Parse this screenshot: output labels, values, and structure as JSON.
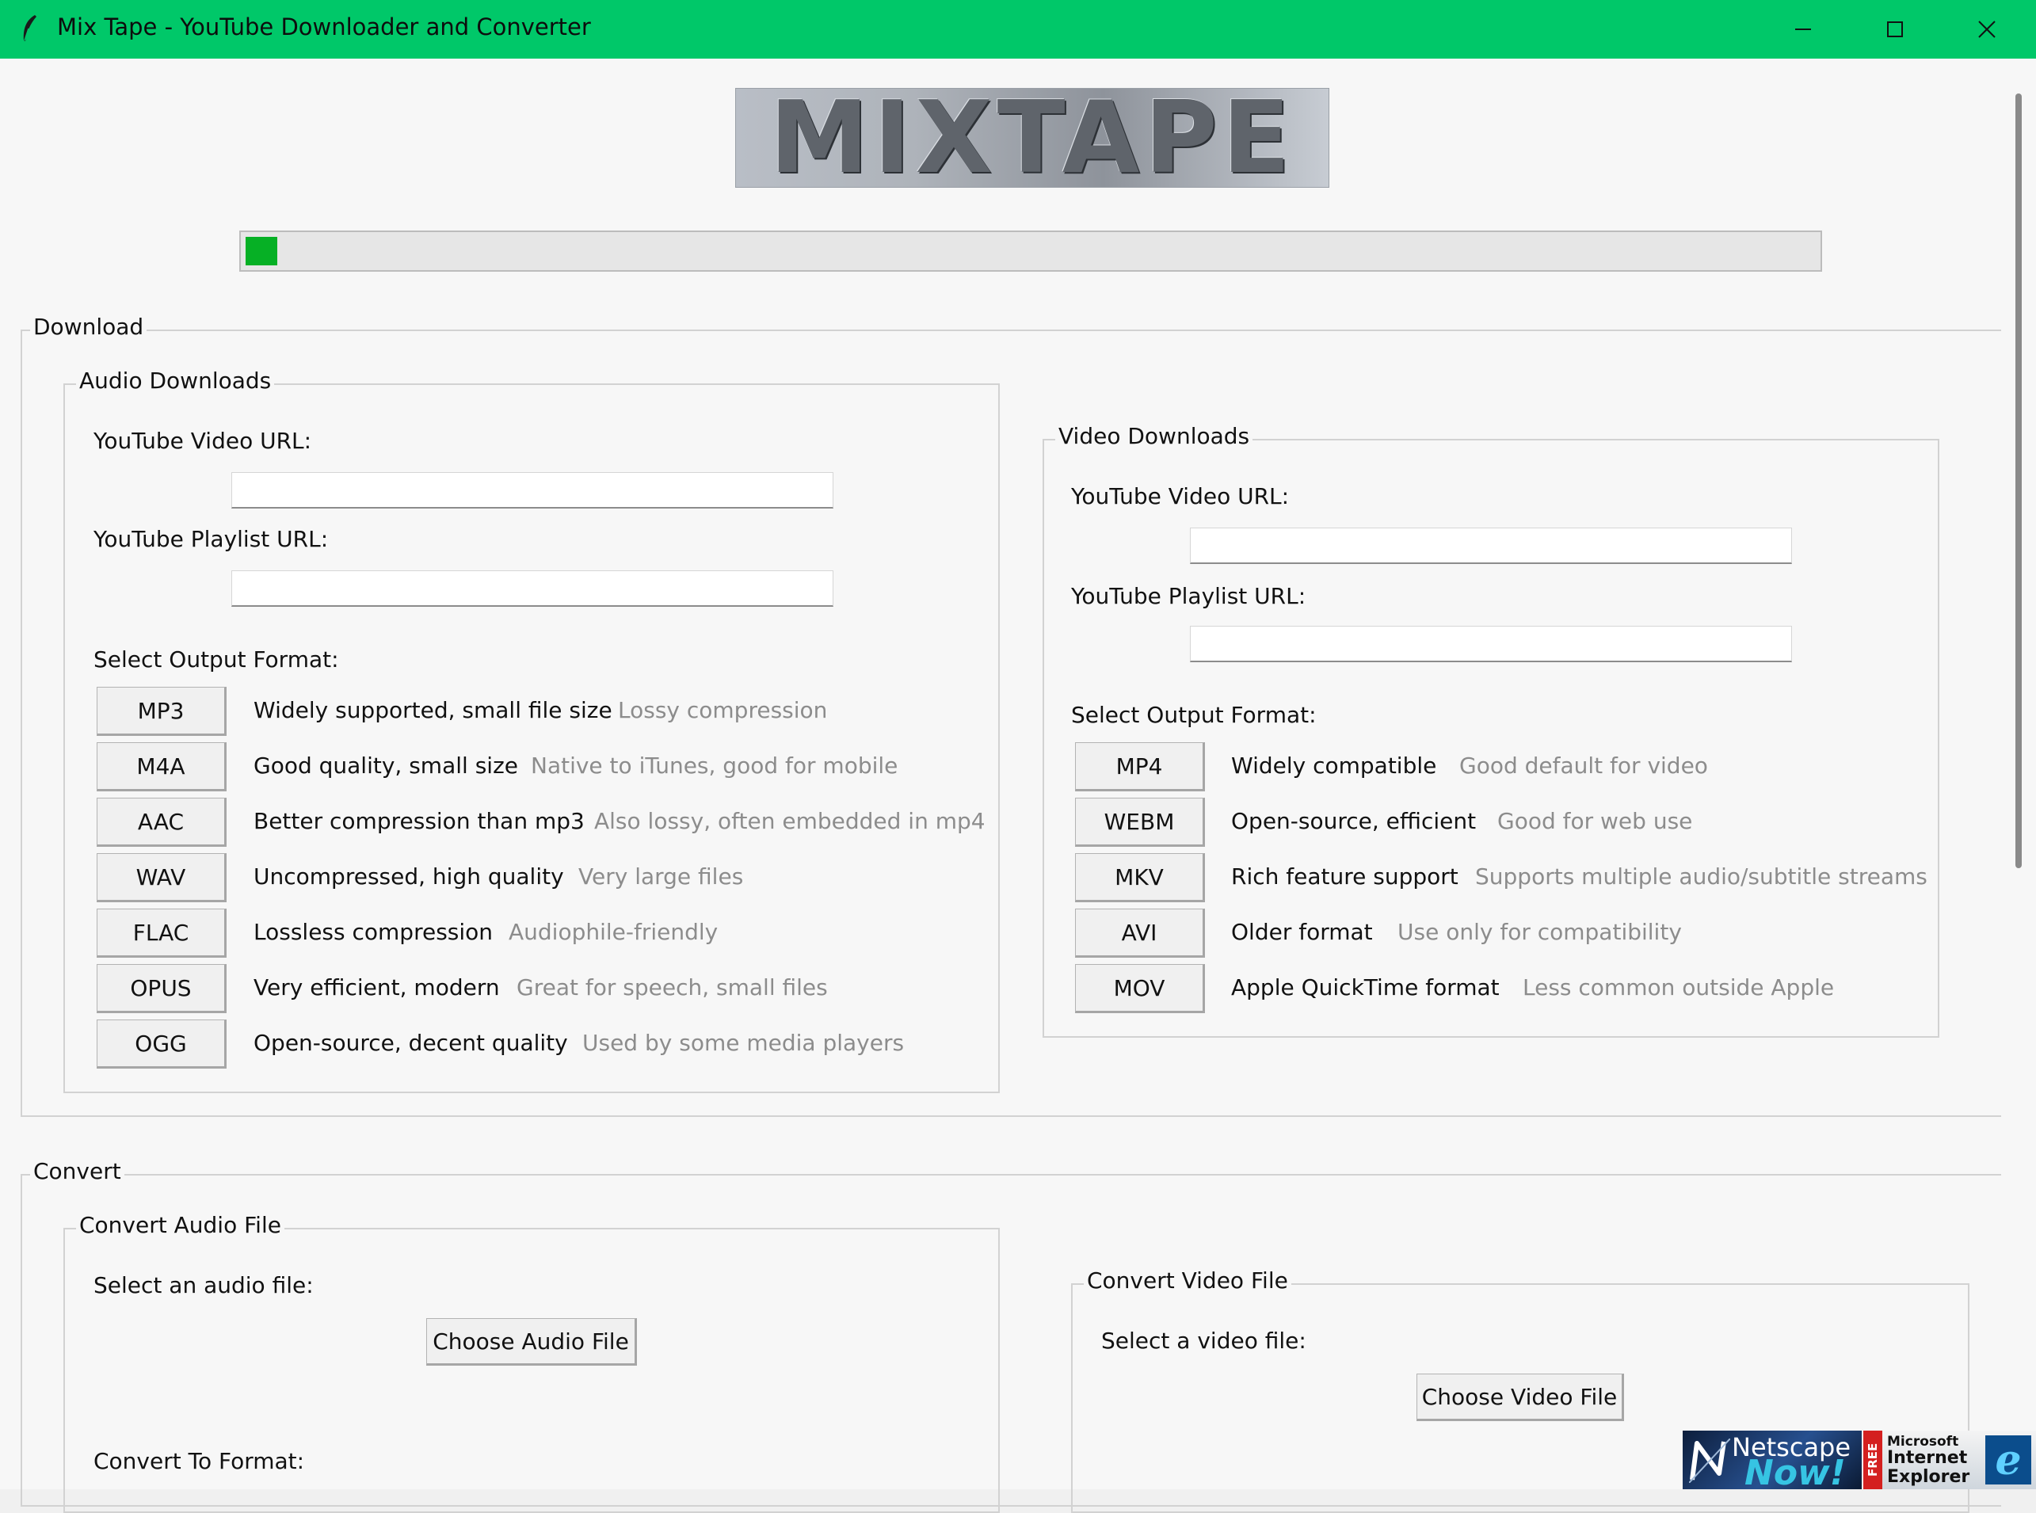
{
  "window": {
    "title": "Mix Tape - YouTube Downloader and Converter",
    "app_icon": "feather-icon",
    "controls": [
      "minimize-icon",
      "maximize-icon",
      "close-icon"
    ]
  },
  "logo": {
    "text": "MIXTAPE"
  },
  "progress": {
    "percent": 2,
    "color": "#06b025"
  },
  "download": {
    "legend": "Download",
    "audio": {
      "legend": "Audio Downloads",
      "video_url_label": "YouTube Video URL:",
      "video_url_value": "",
      "playlist_url_label": "YouTube Playlist URL:",
      "playlist_url_value": "",
      "format_label": "Select Output Format:",
      "formats": [
        {
          "name": "MP3",
          "desc": "Widely supported, small file size",
          "note": "Lossy compression"
        },
        {
          "name": "M4A",
          "desc": "Good quality, small size",
          "note": "Native to iTunes, good for mobile"
        },
        {
          "name": "AAC",
          "desc": "Better compression than mp3",
          "note": "Also lossy, often embedded in mp4"
        },
        {
          "name": "WAV",
          "desc": "Uncompressed, high quality",
          "note": "Very large files"
        },
        {
          "name": "FLAC",
          "desc": "Lossless compression",
          "note": "Audiophile-friendly"
        },
        {
          "name": "OPUS",
          "desc": "Very efficient, modern",
          "note": "Great for speech, small files"
        },
        {
          "name": "OGG",
          "desc": "Open-source, decent quality",
          "note": "Used by some media players"
        }
      ]
    },
    "video": {
      "legend": "Video Downloads",
      "video_url_label": "YouTube Video URL:",
      "video_url_value": "",
      "playlist_url_label": "YouTube Playlist URL:",
      "playlist_url_value": "",
      "format_label": "Select Output Format:",
      "formats": [
        {
          "name": "MP4",
          "desc": "Widely compatible",
          "note": "Good default for video"
        },
        {
          "name": "WEBM",
          "desc": "Open-source, efficient",
          "note": "Good for web use"
        },
        {
          "name": "MKV",
          "desc": "Rich feature support",
          "note": "Supports multiple audio/subtitle streams"
        },
        {
          "name": "AVI",
          "desc": "Older format",
          "note": "Use only for compatibility"
        },
        {
          "name": "MOV",
          "desc": "Apple QuickTime format",
          "note": "Less common outside Apple"
        }
      ]
    }
  },
  "convert": {
    "legend": "Convert",
    "audio": {
      "legend": "Convert Audio File",
      "select_label": "Select an audio file:",
      "button": "Choose Audio File",
      "to_format_label": "Convert To Format:"
    },
    "video": {
      "legend": "Convert Video File",
      "select_label": "Select a video file:",
      "button": "Choose Video File"
    }
  },
  "badges": {
    "netscape": {
      "line1": "Netscape",
      "line2": "Now!"
    },
    "free": "FREE",
    "ie": {
      "line1": "Microsoft",
      "line2": "Internet",
      "line3": "Explorer",
      "logo": "e"
    }
  }
}
